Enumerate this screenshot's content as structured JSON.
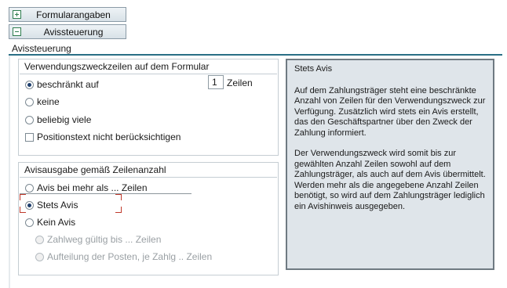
{
  "tabs": [
    {
      "label": "Formularangaben",
      "icon": "expand-plus-icon"
    },
    {
      "label": "Avissteuerung",
      "icon": "collapse-minus-icon"
    }
  ],
  "section": {
    "title": "Avissteuerung"
  },
  "group1": {
    "title": "Verwendungszweckzeilen auf dem Formular",
    "options": [
      {
        "label": "beschränkt auf",
        "selected": true
      },
      {
        "label": "keine",
        "selected": false
      },
      {
        "label": "beliebig viele",
        "selected": false
      }
    ],
    "line_count": "1",
    "line_unit": "Zeilen",
    "checkbox": {
      "label": "Positionstext nicht berücksichtigen",
      "checked": false
    }
  },
  "group2": {
    "title": "Avisausgabe gemäß Zeilenanzahl",
    "options": [
      {
        "label": "Avis bei mehr als ... Zeilen",
        "selected": false
      },
      {
        "label": "Stets Avis",
        "selected": true
      },
      {
        "label": "Kein Avis",
        "selected": false
      }
    ],
    "sub_options": [
      {
        "label": "Zahlweg gültig bis ... Zeilen",
        "enabled": false
      },
      {
        "label": "Aufteilung der Posten, je Zahlg .. Zeilen",
        "enabled": false
      }
    ]
  },
  "help": {
    "title": "Stets Avis",
    "paragraphs": [
      "Auf dem Zahlungsträger steht eine beschränkte Anzahl von Zeilen für den Verwendungszweck zur Verfügung. Zusätzlich wird stets ein Avis erstellt, das den Geschäftspartner über den Zweck der Zahlung informiert.",
      "Der Verwendungszweck wird somit bis zur gewählten Anzahl Zeilen sowohl auf dem Zahlungsträger, als auch auf dem Avis übermittelt. Werden mehr als die angegebene Anzahl Zeilen benötigt, so wird auf dem Zahlungsträger lediglich ein Avishinweis ausgegeben."
    ]
  },
  "colors": {
    "accent_line": "#2a6f86",
    "help_bg": "#dfe5ea",
    "focus": "#c0392b"
  }
}
